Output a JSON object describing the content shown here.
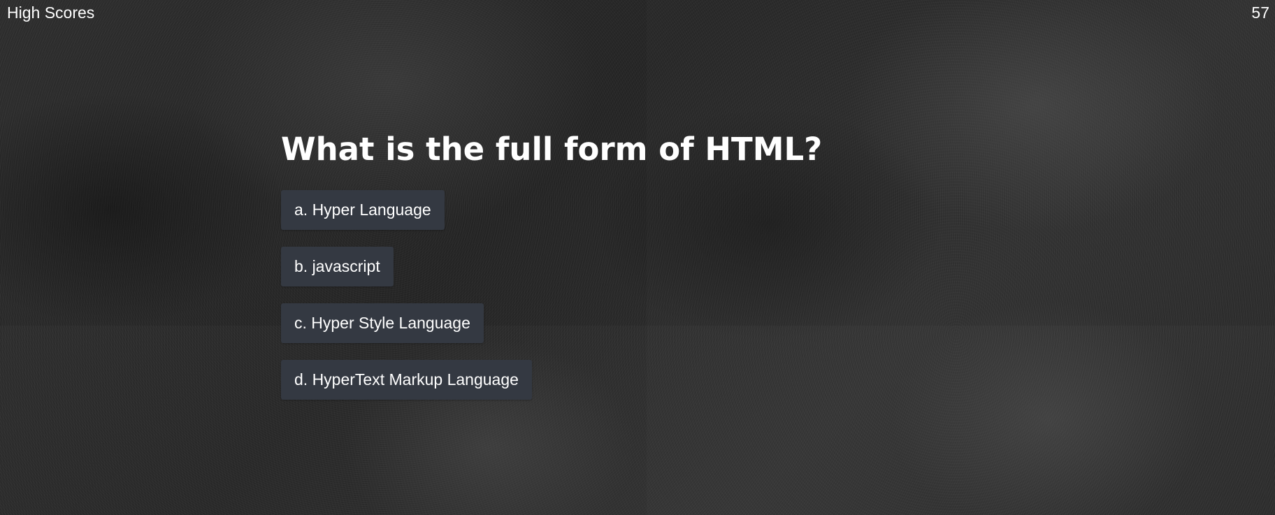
{
  "header": {
    "high_scores_label": "High Scores",
    "timer_value": "57"
  },
  "quiz": {
    "question": "What is the full form of HTML?",
    "choices": [
      {
        "label": "a. Hyper Language"
      },
      {
        "label": "b. javascript"
      },
      {
        "label": "c. Hyper Style Language"
      },
      {
        "label": "d. HyperText Markup Language"
      }
    ]
  },
  "colors": {
    "background": "#2b2b2b",
    "choice_button": "#343942",
    "text": "#ffffff"
  }
}
